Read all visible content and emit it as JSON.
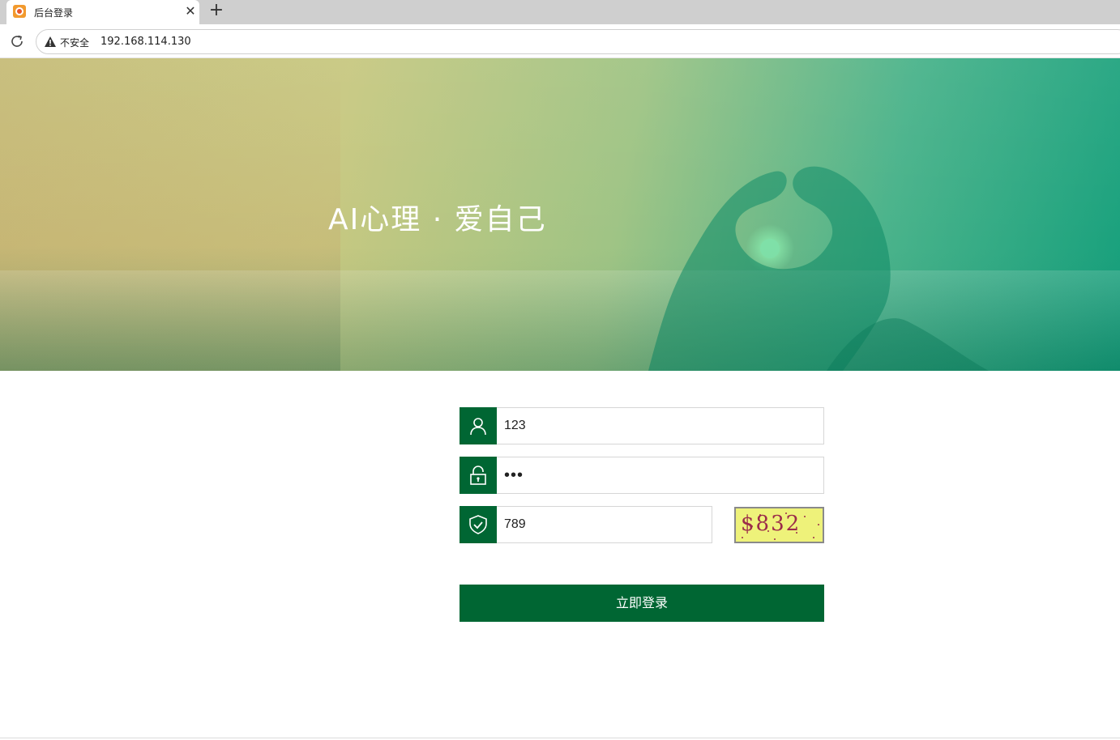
{
  "browser": {
    "tab": {
      "title": "后台登录",
      "close_glyph": "✕"
    },
    "new_tab_glyph": "+",
    "address": {
      "security_label": "不安全",
      "url": "192.168.114.130"
    }
  },
  "banner": {
    "title": "AI心理 · 爱自己"
  },
  "form": {
    "username": {
      "value": "123",
      "icon": "user-icon"
    },
    "password": {
      "value": "•••",
      "icon": "lock-icon"
    },
    "captcha": {
      "value": "789",
      "icon": "shield-check-icon",
      "image_text": "$832"
    },
    "submit_label": "立即登录"
  },
  "colors": {
    "primary": "#006633",
    "captcha_bg": "#eef27a",
    "captcha_text": "#9b2b4a"
  }
}
